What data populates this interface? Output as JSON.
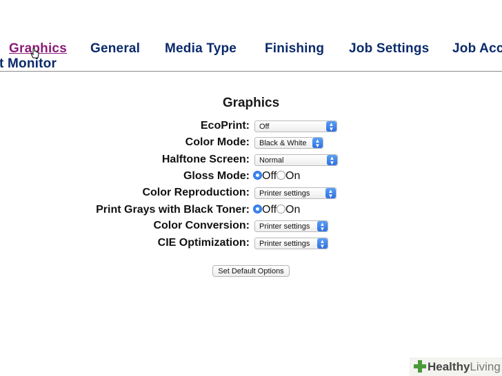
{
  "nav": {
    "tabs": [
      {
        "label": "Graphics",
        "active": true
      },
      {
        "label": "General"
      },
      {
        "label": "Media Type"
      },
      {
        "label": "Finishing"
      },
      {
        "label": "Job Settings"
      },
      {
        "label": "Job Acc"
      },
      {
        "label": "t Monitor"
      }
    ]
  },
  "form": {
    "title": "Graphics",
    "rows": [
      {
        "label": "EcoPrint:",
        "type": "select",
        "value": "Off"
      },
      {
        "label": "Color Mode:",
        "type": "select",
        "value": "Black & White"
      },
      {
        "label": "Halftone Screen:",
        "type": "select",
        "value": "Normal"
      },
      {
        "label": "Gloss Mode:",
        "type": "radio",
        "options": [
          "Off",
          "On"
        ],
        "selected": "Off"
      },
      {
        "label": "Color Reproduction:",
        "type": "select",
        "value": "Printer settings"
      },
      {
        "label": "Print Grays with Black Toner:",
        "type": "radio",
        "options": [
          "Off",
          "On"
        ],
        "selected": "Off"
      },
      {
        "label": "Color Conversion:",
        "type": "select",
        "value": "Printer settings"
      },
      {
        "label": "CIE Optimization:",
        "type": "select",
        "value": "Printer settings"
      }
    ],
    "default_button": "Set Default Options"
  },
  "watermark": {
    "brand": "Healthy",
    "suffix": "Living"
  },
  "colors": {
    "tab_active": "#8b1c7a",
    "tab": "#0a2a6b",
    "radio_selected": "#3b86f0",
    "watermark_plus": "#4a9a3a"
  }
}
